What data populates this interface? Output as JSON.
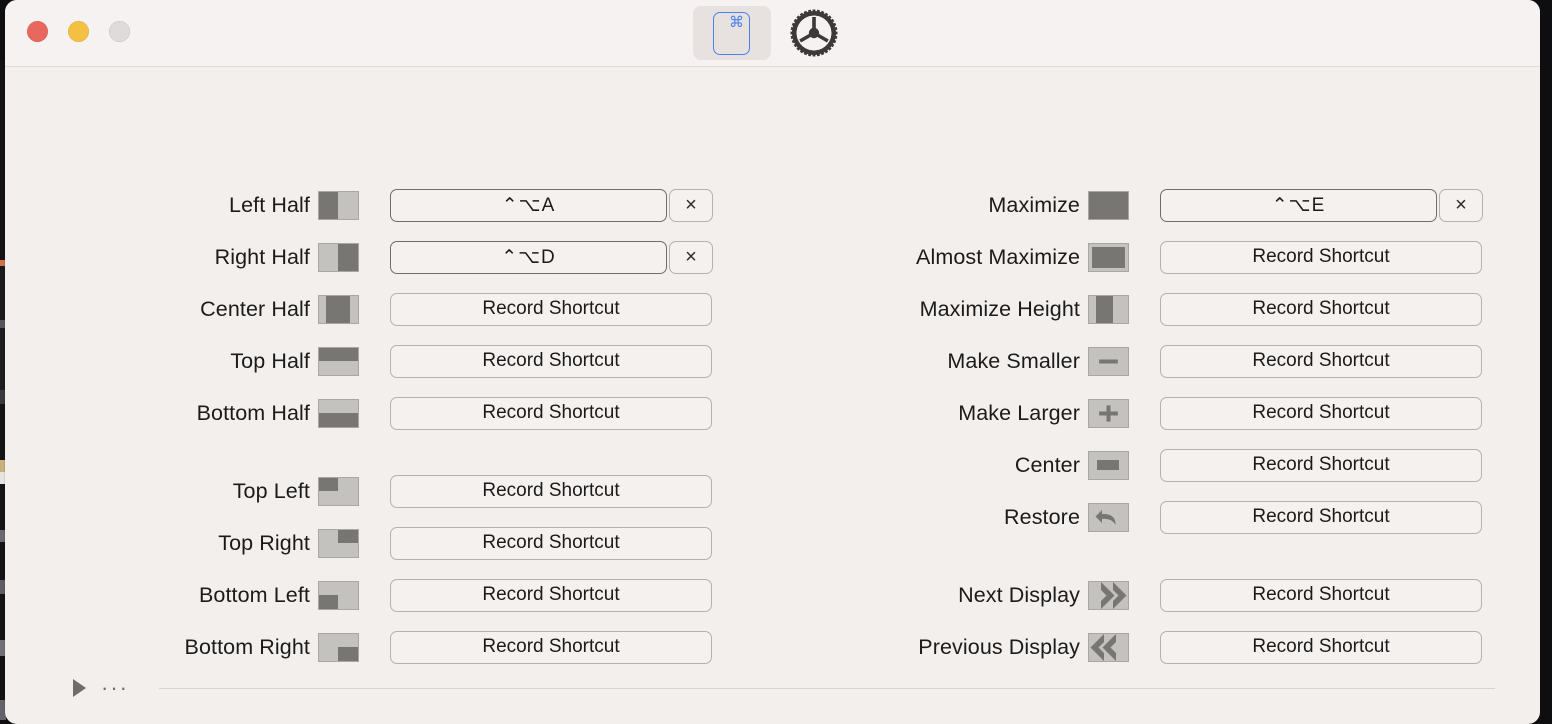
{
  "window": {
    "traffic_lights": [
      {
        "name": "close",
        "color": "#e8685f"
      },
      {
        "name": "minimize",
        "color": "#f3c043"
      },
      {
        "name": "zoom",
        "color": "#dedcda"
      }
    ]
  },
  "toolbar": {
    "items": [
      {
        "id": "shortcuts",
        "icon": "command-key-icon",
        "glyph": "⌘",
        "selected": true
      },
      {
        "id": "settings",
        "icon": "gear-icon",
        "glyph": "",
        "selected": false
      }
    ]
  },
  "buttons": {
    "record_shortcut": "Record Shortcut",
    "clear_glyph": "×"
  },
  "left_column": [
    {
      "label": "Left Half",
      "thumb": "left-half",
      "shortcut": "⌃⌥A",
      "has_shortcut": true,
      "gap_before": false
    },
    {
      "label": "Right Half",
      "thumb": "right-half",
      "shortcut": "⌃⌥D",
      "has_shortcut": true,
      "gap_before": false
    },
    {
      "label": "Center Half",
      "thumb": "center-half",
      "shortcut": "",
      "has_shortcut": false,
      "gap_before": false
    },
    {
      "label": "Top Half",
      "thumb": "top-half",
      "shortcut": "",
      "has_shortcut": false,
      "gap_before": false
    },
    {
      "label": "Bottom Half",
      "thumb": "bottom-half",
      "shortcut": "",
      "has_shortcut": false,
      "gap_before": false
    },
    {
      "label": "Top Left",
      "thumb": "top-left",
      "shortcut": "",
      "has_shortcut": false,
      "gap_before": true
    },
    {
      "label": "Top Right",
      "thumb": "top-right",
      "shortcut": "",
      "has_shortcut": false,
      "gap_before": false
    },
    {
      "label": "Bottom Left",
      "thumb": "bottom-left",
      "shortcut": "",
      "has_shortcut": false,
      "gap_before": false
    },
    {
      "label": "Bottom Right",
      "thumb": "bottom-right",
      "shortcut": "",
      "has_shortcut": false,
      "gap_before": false
    }
  ],
  "right_column": [
    {
      "label": "Maximize",
      "thumb": "maximize",
      "shortcut": "⌃⌥E",
      "has_shortcut": true,
      "gap_before": false
    },
    {
      "label": "Almost Maximize",
      "thumb": "almost-maximize",
      "shortcut": "",
      "has_shortcut": false,
      "gap_before": false
    },
    {
      "label": "Maximize Height",
      "thumb": "maximize-height",
      "shortcut": "",
      "has_shortcut": false,
      "gap_before": false
    },
    {
      "label": "Make Smaller",
      "thumb": "make-smaller",
      "shortcut": "",
      "has_shortcut": false,
      "gap_before": false
    },
    {
      "label": "Make Larger",
      "thumb": "make-larger",
      "shortcut": "",
      "has_shortcut": false,
      "gap_before": false
    },
    {
      "label": "Center",
      "thumb": "center",
      "shortcut": "",
      "has_shortcut": false,
      "gap_before": false
    },
    {
      "label": "Restore",
      "thumb": "restore",
      "shortcut": "",
      "has_shortcut": false,
      "gap_before": false
    },
    {
      "label": "Next Display",
      "thumb": "next-display",
      "shortcut": "",
      "has_shortcut": false,
      "gap_before": true
    },
    {
      "label": "Previous Display",
      "thumb": "previous-display",
      "shortcut": "",
      "has_shortcut": false,
      "gap_before": false
    }
  ],
  "footer": {
    "disclosure_icon": "disclosure-triangle-right-icon",
    "ellipsis": "···"
  },
  "colors": {
    "window_bg": "#f2efed",
    "titlebar_bg": "#f6f2f1",
    "accent": "#4a82f0",
    "thumb_light": "#c4c2bf",
    "thumb_dark": "#787672"
  }
}
